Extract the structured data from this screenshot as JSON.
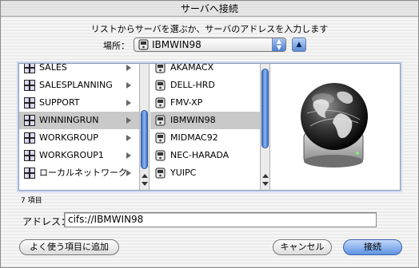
{
  "window": {
    "title": "サーバへ接続"
  },
  "instruction": "リストからサーバを選ぶか、サーバのアドレスを入力します",
  "location": {
    "label": "場所：",
    "value": "IBMWIN98"
  },
  "left_column": [
    {
      "label": "SALES",
      "selected": false
    },
    {
      "label": "SALESPLANNING",
      "selected": false
    },
    {
      "label": "SUPPORT",
      "selected": false
    },
    {
      "label": "WINNINGRUN",
      "selected": true
    },
    {
      "label": "WORKGROUP",
      "selected": false
    },
    {
      "label": "WORKGROUP1",
      "selected": false
    },
    {
      "label": "ローカルネットワーク",
      "selected": false
    }
  ],
  "right_column": [
    {
      "label": "AKAMACX",
      "selected": false
    },
    {
      "label": "DELL-HRD",
      "selected": false
    },
    {
      "label": "FMV-XP",
      "selected": false
    },
    {
      "label": "IBMWIN98",
      "selected": true
    },
    {
      "label": "MIDMAC92",
      "selected": false
    },
    {
      "label": "NEC-HARADA",
      "selected": false
    },
    {
      "label": "YUIPC",
      "selected": false
    }
  ],
  "item_count": "7 項目",
  "address": {
    "label": "アドレス：",
    "value": "cifs://IBMWIN98"
  },
  "buttons": {
    "add_favorite": "よく使う項目に追加",
    "cancel": "キャンセル",
    "connect": "接続"
  },
  "colors": {
    "accent": "#4b7fd4",
    "selection": "#c9c9c9"
  },
  "icons": {
    "group": "workgroup-icon",
    "server": "server-icon",
    "preview": "globe-drive-icon"
  }
}
